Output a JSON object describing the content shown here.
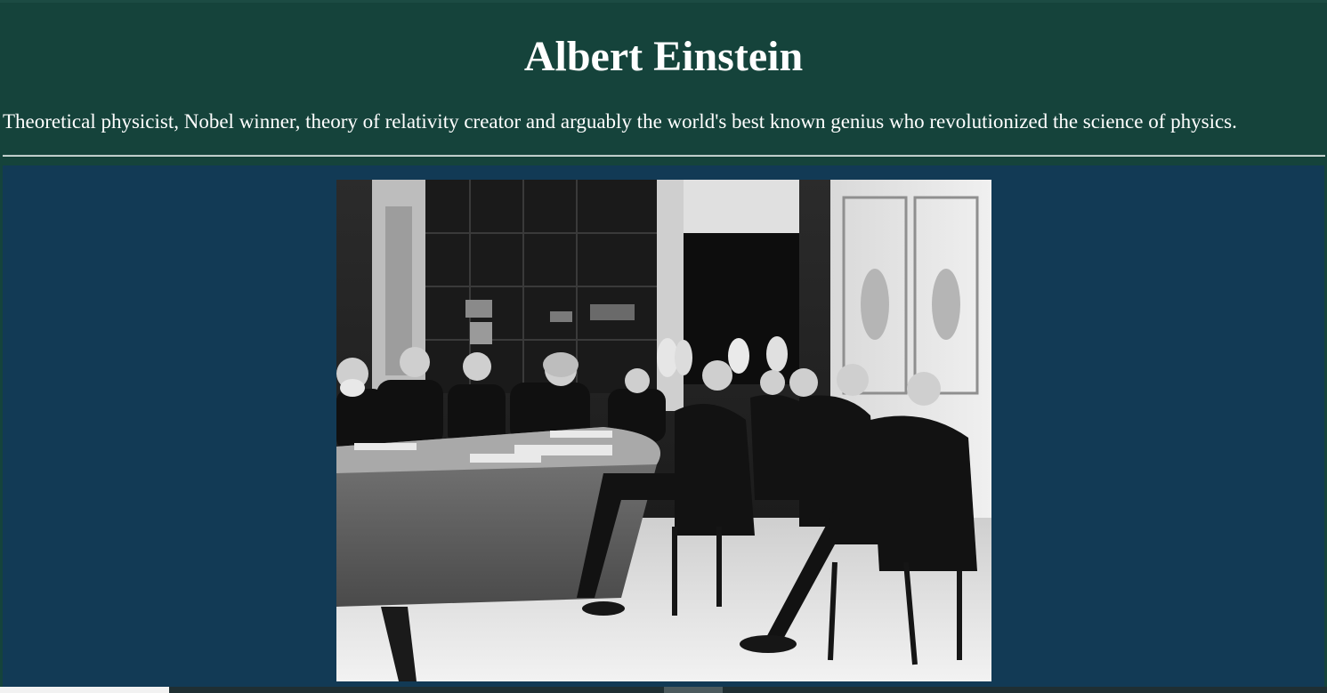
{
  "header": {
    "title": "Albert Einstein",
    "subtitle": "Theoretical physicist, Nobel winner, theory of relativity creator and arguably the world's best known genius who revolutionized the science of physics."
  },
  "photo": {
    "icon": "group-photo-image",
    "description_visible": false
  },
  "colors": {
    "header_bg": "#15433b",
    "content_bg": "#123a55",
    "text": "#ffffff"
  }
}
